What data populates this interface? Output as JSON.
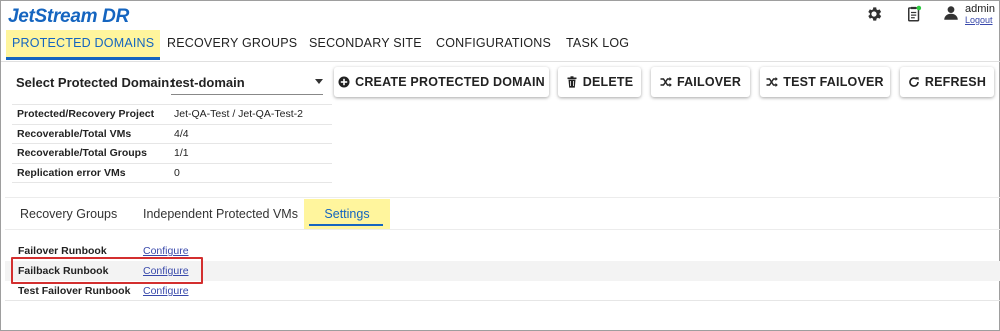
{
  "app": {
    "logo": "JetStream DR"
  },
  "header": {
    "username": "admin",
    "logout_label": "Logout"
  },
  "nav": {
    "items": [
      {
        "label": "PROTECTED DOMAINS",
        "active": true
      },
      {
        "label": "RECOVERY GROUPS",
        "active": false
      },
      {
        "label": "SECONDARY SITE",
        "active": false
      },
      {
        "label": "CONFIGURATIONS",
        "active": false
      },
      {
        "label": "TASK LOG",
        "active": false
      }
    ]
  },
  "domain_select": {
    "label": "Select Protected Domain:",
    "value": "test-domain"
  },
  "actions": {
    "create": "CREATE PROTECTED DOMAIN",
    "delete": "DELETE",
    "failover": "FAILOVER",
    "test_failover": "TEST FAILOVER",
    "refresh": "REFRESH"
  },
  "summary": [
    {
      "key": "Protected/Recovery Project",
      "value": "Jet-QA-Test / Jet-QA-Test-2"
    },
    {
      "key": "Recoverable/Total VMs",
      "value": "4/4"
    },
    {
      "key": "Recoverable/Total Groups",
      "value": "1/1"
    },
    {
      "key": "Replication error VMs",
      "value": "0"
    }
  ],
  "subtabs": [
    {
      "label": "Recovery Groups",
      "active": false
    },
    {
      "label": "Independent Protected VMs",
      "active": false
    },
    {
      "label": "Settings",
      "active": true
    }
  ],
  "runbooks": [
    {
      "label": "Failover Runbook",
      "link": "Configure"
    },
    {
      "label": "Failback Runbook",
      "link": "Configure",
      "highlighted": true
    },
    {
      "label": "Test Failover Runbook",
      "link": "Configure"
    }
  ],
  "colors": {
    "brand": "#1565c0",
    "highlight": "#fff59d",
    "callout": "#d32f2f",
    "link": "#3949ab"
  },
  "icons": {
    "header": [
      "gear-icon",
      "task-clipboard-icon",
      "user-icon"
    ],
    "buttons": [
      "plus-circle-icon",
      "trash-icon",
      "shuffle-icon",
      "shuffle-icon",
      "refresh-icon"
    ]
  }
}
